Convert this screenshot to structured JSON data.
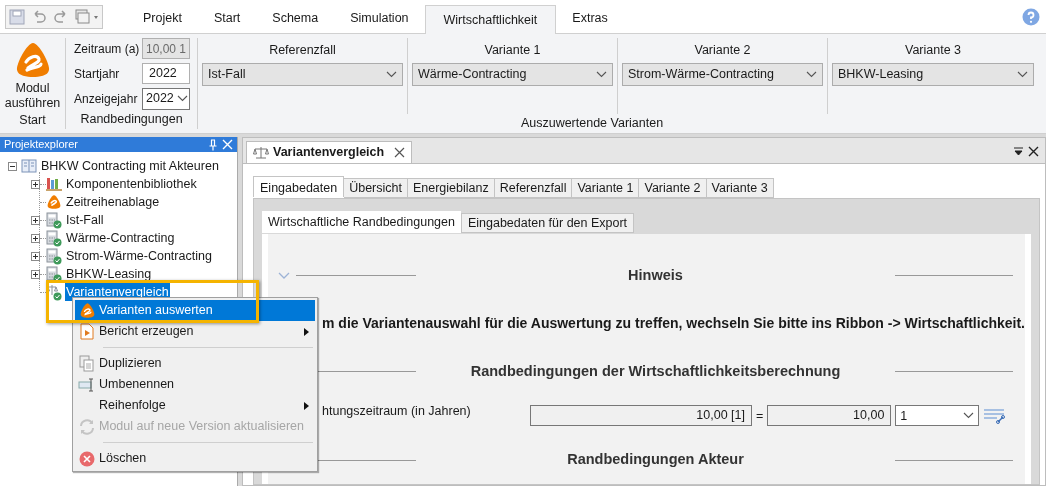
{
  "ribbon": {
    "tabs": [
      {
        "label": "Projekt",
        "selected": false
      },
      {
        "label": "Start",
        "selected": false
      },
      {
        "label": "Schema",
        "selected": false
      },
      {
        "label": "Simulation",
        "selected": false
      },
      {
        "label": "Wirtschaftlichkeit",
        "selected": true
      },
      {
        "label": "Extras",
        "selected": false
      }
    ],
    "start_group": {
      "button": "Modul ausführen",
      "label": "Start"
    },
    "conditions_group": {
      "label": "Randbedingungen",
      "fields": [
        {
          "label": "Zeitraum (a)",
          "value": "10,00 1",
          "kind": "readonly"
        },
        {
          "label": "Startjahr",
          "value": "2022",
          "kind": "input"
        },
        {
          "label": "Anzeigejahr",
          "value": "2022",
          "kind": "dropdown"
        }
      ]
    },
    "variants_group": {
      "label": "Auszuwertende Varianten",
      "selectors": [
        {
          "title": "Referenzfall",
          "value": "Ist-Fall"
        },
        {
          "title": "Variante 1",
          "value": "Wärme-Contracting"
        },
        {
          "title": "Variante 2",
          "value": "Strom-Wärme-Contracting"
        },
        {
          "title": "Variante 3",
          "value": "BHKW-Leasing"
        }
      ]
    }
  },
  "explorer": {
    "title": "Projektexplorer",
    "tree": {
      "label": "BHKW Contracting mit Akteuren",
      "expanded": true,
      "children": [
        {
          "label": "Komponentenbibliothek",
          "kind": "library",
          "has_children": true,
          "selected": false
        },
        {
          "label": "Zeitreihenablage",
          "kind": "timeseries",
          "has_children": false,
          "selected": false
        },
        {
          "label": "Ist-Fall",
          "kind": "variant",
          "has_children": true,
          "selected": false
        },
        {
          "label": "Wärme-Contracting",
          "kind": "variant",
          "has_children": true,
          "selected": false
        },
        {
          "label": "Strom-Wärme-Contracting",
          "kind": "variant",
          "has_children": true,
          "selected": false
        },
        {
          "label": "BHKW-Leasing",
          "kind": "variant",
          "has_children": true,
          "selected": false
        },
        {
          "label": "Variantenvergleich",
          "kind": "comparison",
          "has_children": false,
          "selected": true
        }
      ]
    }
  },
  "context_menu": {
    "highlighted": true,
    "items": [
      {
        "kind": "evaluate",
        "label": "Varianten auswerten",
        "selected": true,
        "disabled": false,
        "submenu": false
      },
      {
        "kind": "report",
        "label": "Bericht erzeugen",
        "selected": false,
        "disabled": false,
        "submenu": true
      },
      {
        "kind": "separator"
      },
      {
        "kind": "duplicate",
        "label": "Duplizieren",
        "selected": false,
        "disabled": false,
        "submenu": false
      },
      {
        "kind": "rename",
        "label": "Umbenennen",
        "selected": false,
        "disabled": false,
        "submenu": false
      },
      {
        "kind": "order",
        "label": "Reihenfolge",
        "selected": false,
        "disabled": false,
        "submenu": true
      },
      {
        "kind": "update",
        "label": "Modul auf neue Version aktualisieren",
        "selected": false,
        "disabled": true,
        "submenu": false
      },
      {
        "kind": "separator"
      },
      {
        "kind": "delete",
        "label": "Löschen",
        "selected": false,
        "disabled": false,
        "submenu": false
      }
    ]
  },
  "document": {
    "tab": "Variantenvergleich",
    "tabs": [
      {
        "label": "Eingabedaten",
        "selected": true
      },
      {
        "label": "Übersicht",
        "selected": false
      },
      {
        "label": "Energiebilanz",
        "selected": false
      },
      {
        "label": "Referenzfall",
        "selected": false
      },
      {
        "label": "Variante 1",
        "selected": false
      },
      {
        "label": "Variante 2",
        "selected": false
      },
      {
        "label": "Variante 3",
        "selected": false
      }
    ],
    "subtabs": [
      {
        "label": "Wirtschaftliche Randbedingungen",
        "selected": true
      },
      {
        "label": "Eingabedaten für den Export",
        "selected": false
      }
    ],
    "sections": [
      {
        "kind": "heading",
        "title": "Hinweis",
        "collapsible": true
      },
      {
        "kind": "text",
        "text": "m die Variantenauswahl für die Auswertung zu treffen, wechseln Sie bitte ins Ribbon -> Wirtschaftlichkeit."
      },
      {
        "kind": "heading",
        "title": "Randbedingungen der Wirtschaftlichkeitsberechnung"
      },
      {
        "kind": "field_row",
        "label": "htungszeitraum (in Jahren)",
        "formula": "10,00 [1]",
        "equals": "=",
        "result": "10,00",
        "unit": "1"
      },
      {
        "kind": "heading",
        "title": "Randbedingungen Akteur"
      }
    ]
  }
}
